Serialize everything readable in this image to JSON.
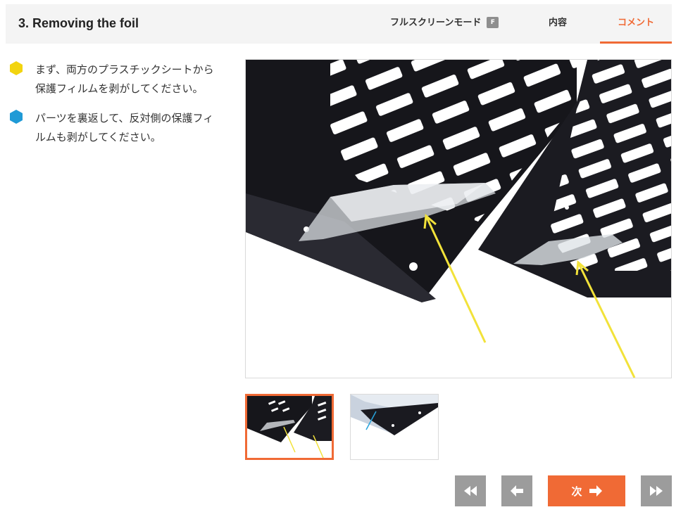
{
  "header": {
    "title": "3. Removing the foil",
    "tabs": {
      "fullscreen": "フルスクリーンモード",
      "fullscreen_key": "F",
      "contents": "内容",
      "comments": "コメント"
    }
  },
  "steps": [
    {
      "color": "#f2d40f",
      "text": "まず、両方のプラスチックシートから保護フィルムを剥がしてください。"
    },
    {
      "color": "#1f9ad6",
      "text": "パーツを裏返して、反対側の保護フィルムも剥がしてください。"
    }
  ],
  "navigation": {
    "next_label": "次"
  },
  "colors": {
    "accent": "#f06a35",
    "nav_gray": "#9c9c9c",
    "arrow_yellow": "#f2e23a"
  }
}
